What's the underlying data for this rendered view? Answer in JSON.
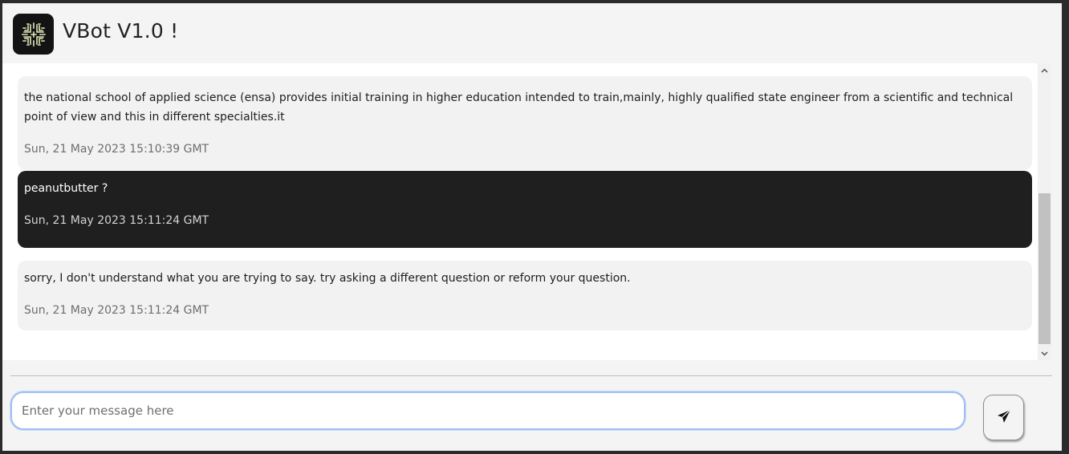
{
  "header": {
    "title": "VBot V1.0 !",
    "logo_icon": "maze-brain-icon"
  },
  "messages": [
    {
      "sender": "bot",
      "text": "the national school of applied science (ensa) provides initial training in higher education intended to train,mainly, highly qualified state engineer from a scientific and technical point of view and this in different specialties.it",
      "time": "Sun, 21 May 2023 15:10:39 GMT"
    },
    {
      "sender": "user",
      "text": "peanutbutter ?",
      "time": "Sun, 21 May 2023 15:11:24 GMT"
    },
    {
      "sender": "bot",
      "text": "sorry, I don't understand what you are trying to say. try asking a different question or reform your question.",
      "time": "Sun, 21 May 2023 15:11:24 GMT"
    }
  ],
  "composer": {
    "placeholder": "Enter your message here",
    "value": "",
    "send_icon": "paper-plane-icon"
  },
  "colors": {
    "user_bubble": "#1f1f1f",
    "bot_bubble": "#f2f2f2",
    "input_focus": "#9ec0f0"
  }
}
